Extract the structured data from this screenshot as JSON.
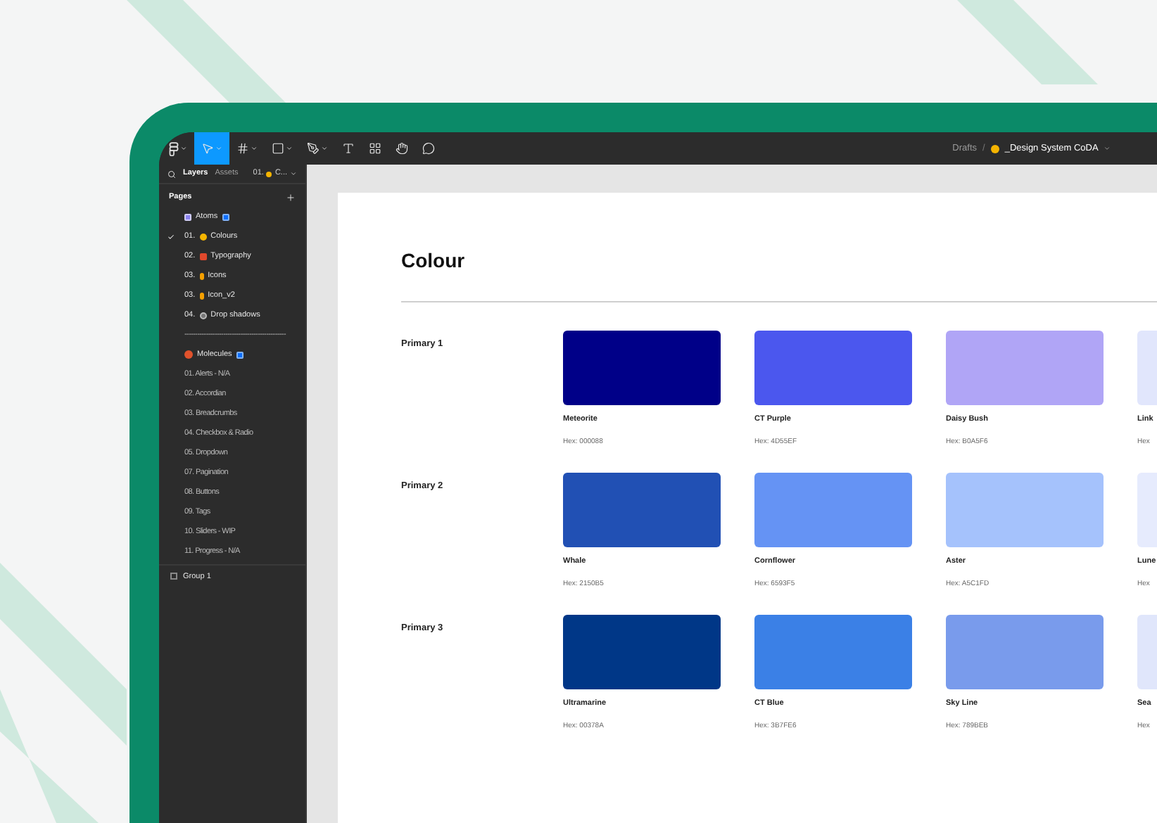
{
  "toolbar": {
    "tools": [
      {
        "kind": "logo",
        "selected": false,
        "menu": true
      },
      {
        "kind": "move",
        "selected": true,
        "menu": true
      },
      {
        "kind": "frame",
        "selected": false,
        "menu": true
      },
      {
        "kind": "shape",
        "selected": false,
        "menu": true
      },
      {
        "kind": "pen",
        "selected": false,
        "menu": true
      },
      {
        "kind": "text",
        "selected": false,
        "menu": false
      },
      {
        "kind": "components",
        "selected": false,
        "menu": false
      },
      {
        "kind": "hand",
        "selected": false,
        "menu": false
      },
      {
        "kind": "comment",
        "selected": false,
        "menu": false
      }
    ],
    "breadcrumb": {
      "parent": "Drafts",
      "separator": "/",
      "file": "_Design System CoDA"
    }
  },
  "sidebar": {
    "tabs": [
      {
        "label": "Layers",
        "selected": true
      },
      {
        "label": "Assets",
        "selected": false
      }
    ],
    "page_selector": {
      "number": "01.",
      "label": "C..."
    },
    "pages_header": "Pages",
    "pages": [
      {
        "kind": "section",
        "label": "Atoms",
        "badge": true,
        "current": false
      },
      {
        "kind": "emoji",
        "label": "01.",
        "name": "Colours",
        "badge": false,
        "current": true
      },
      {
        "kind": "emoji",
        "label": "02.",
        "name": "Typography",
        "badge": false,
        "current": false
      },
      {
        "kind": "emoji",
        "label": "03.",
        "name": "Icons",
        "badge": false,
        "current": false
      },
      {
        "kind": "emoji",
        "label": "03.",
        "name": "Icon_v2",
        "badge": false,
        "current": false
      },
      {
        "kind": "emoji",
        "label": "04.",
        "name": "Drop shadows",
        "badge": false,
        "current": false
      },
      {
        "kind": "plain",
        "label": "-----------------------------------------------",
        "badge": false,
        "current": false
      },
      {
        "kind": "section",
        "label": "Molecules",
        "badge": true,
        "current": false
      },
      {
        "kind": "plain",
        "label": "01. Alerts - N/A",
        "badge": false,
        "current": false
      },
      {
        "kind": "plain",
        "label": "02. Accordian",
        "badge": false,
        "current": false
      },
      {
        "kind": "plain",
        "label": "03. Breadcrumbs",
        "badge": false,
        "current": false
      },
      {
        "kind": "plain",
        "label": "04. Checkbox & Radio",
        "badge": false,
        "current": false
      },
      {
        "kind": "plain",
        "label": "05. Dropdown",
        "badge": false,
        "current": false
      },
      {
        "kind": "plain",
        "label": "07. Pagination",
        "badge": false,
        "current": false
      },
      {
        "kind": "plain",
        "label": "08. Buttons",
        "badge": false,
        "current": false
      },
      {
        "kind": "plain",
        "label": "09. Tags",
        "badge": false,
        "current": false
      },
      {
        "kind": "plain",
        "label": "10. Sliders - WIP",
        "badge": false,
        "current": false
      },
      {
        "kind": "plain",
        "label": "11. Progress - N/A",
        "badge": false,
        "current": false
      }
    ],
    "layers": [
      {
        "label": "Group 1"
      }
    ]
  },
  "canvas": {
    "title": "Colour",
    "groups": [
      {
        "label": "Primary 1",
        "swatches": [
          {
            "name": "Meteorite",
            "hex": "Hex: 000088",
            "color": "#000088"
          },
          {
            "name": "CT Purple",
            "hex": "Hex: 4D55EF",
            "color": "#4b57ee"
          },
          {
            "name": "Daisy Bush",
            "hex": "Hex: B0A5F6",
            "color": "#b0a5f6"
          },
          {
            "name": "Link",
            "hex": "Hex",
            "color": "#e1e6fc"
          }
        ]
      },
      {
        "label": "Primary 2",
        "swatches": [
          {
            "name": "Whale",
            "hex": "Hex: 2150B5",
            "color": "#2150b4"
          },
          {
            "name": "Cornflower",
            "hex": "Hex: 6593F5",
            "color": "#6593f4"
          },
          {
            "name": "Aster",
            "hex": "Hex: A5C1FD",
            "color": "#a5c2fc"
          },
          {
            "name": "Lune",
            "hex": "Hex",
            "color": "#e6ebfd"
          }
        ]
      },
      {
        "label": "Primary 3",
        "swatches": [
          {
            "name": "Ultramarine",
            "hex": "Hex: 00378A",
            "color": "#003787"
          },
          {
            "name": "CT Blue",
            "hex": "Hex: 3B7FE6",
            "color": "#3b80e6"
          },
          {
            "name": "Sky Line",
            "hex": "Hex: 789BEB",
            "color": "#799bec"
          },
          {
            "name": "Sea",
            "hex": "Hex",
            "color": "#e0e6fb"
          }
        ]
      }
    ]
  }
}
